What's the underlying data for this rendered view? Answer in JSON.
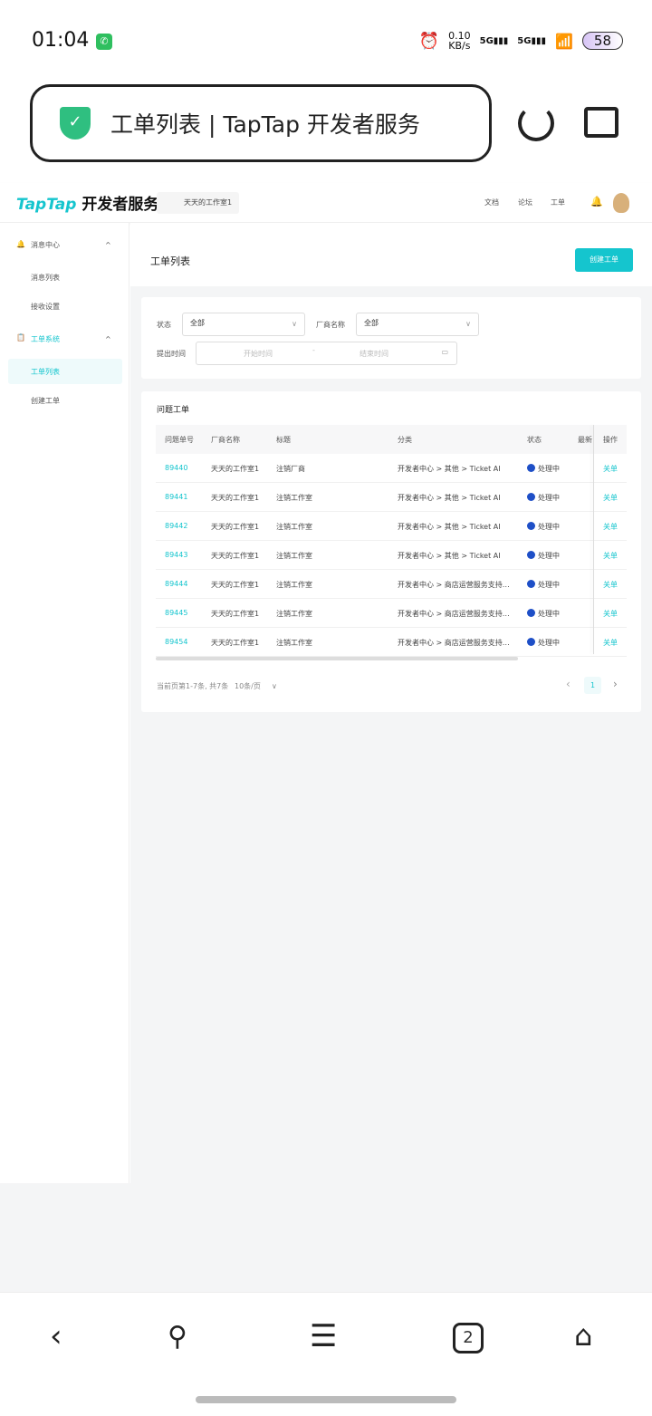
{
  "status_bar": {
    "time": "01:04",
    "speed": "0.10",
    "speed_unit": "KB/s",
    "net1": "5G",
    "net2": "5G",
    "battery": "58"
  },
  "browser": {
    "title": "工单列表 | TapTap 开发者服务",
    "tabs_count": "2"
  },
  "header": {
    "logo": "TapTap",
    "logo_cn": "开发者服务",
    "studio": "天天的工作室1",
    "nav": [
      "文档",
      "论坛",
      "工单"
    ]
  },
  "sidebar": {
    "groups": [
      {
        "label": "消息中心",
        "items": [
          "消息列表",
          "接收设置"
        ]
      },
      {
        "label": "工单系统",
        "items": [
          "工单列表",
          "创建工单"
        ]
      }
    ]
  },
  "page": {
    "title": "工单列表",
    "create_button": "创建工单"
  },
  "filters": {
    "status_label": "状态",
    "status_value": "全部",
    "vendor_label": "厂商名称",
    "vendor_value": "全部",
    "time_label": "提出时间",
    "start_placeholder": "开始时间",
    "sep": "-",
    "end_placeholder": "结束时间"
  },
  "table": {
    "title": "问题工单",
    "headers": [
      "问题单号",
      "厂商名称",
      "标题",
      "分类",
      "状态",
      "最新",
      "操作"
    ],
    "rows": [
      [
        "89440",
        "天天的工作室1",
        "注销厂商",
        "开发者中心 > 其他 > Ticket AI",
        "处理中",
        "关单"
      ],
      [
        "89441",
        "天天的工作室1",
        "注销工作室",
        "开发者中心 > 其他 > Ticket AI",
        "处理中",
        "关单"
      ],
      [
        "89442",
        "天天的工作室1",
        "注销工作室",
        "开发者中心 > 其他 > Ticket AI",
        "处理中",
        "关单"
      ],
      [
        "89443",
        "天天的工作室1",
        "注销工作室",
        "开发者中心 > 其他 > Ticket AI",
        "处理中",
        "关单"
      ],
      [
        "89444",
        "天天的工作室1",
        "注销工作室",
        "开发者中心 > 商店运营服务支持…",
        "处理中",
        "关单"
      ],
      [
        "89445",
        "天天的工作室1",
        "注销工作室",
        "开发者中心 > 商店运营服务支持…",
        "处理中",
        "关单"
      ],
      [
        "89454",
        "天天的工作室1",
        "注销工作室",
        "开发者中心 > 商店运营服务支持…",
        "处理中",
        "关单"
      ]
    ]
  },
  "pagination": {
    "summary": "当前页第1-7条, 共7条",
    "page_size": "10条/页",
    "current": "1",
    "prev": "‹",
    "next": "›"
  },
  "colors": {
    "accent": "#15c5ce",
    "status": "#1e4fc7"
  }
}
